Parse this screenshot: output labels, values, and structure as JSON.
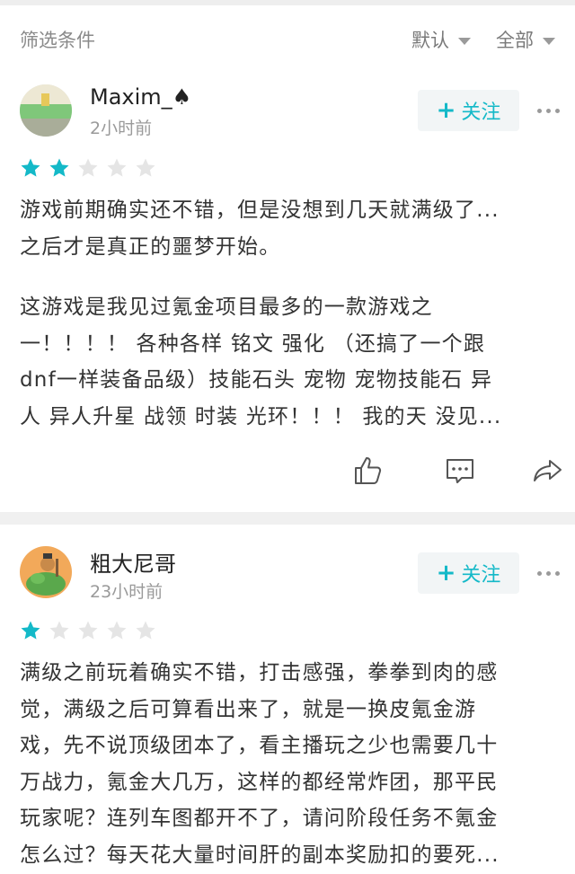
{
  "filter": {
    "label": "筛选条件",
    "sort": "默认",
    "scope": "全部"
  },
  "reviews": [
    {
      "username": "Maxim_♠",
      "time": "2小时前",
      "follow_label": "关注",
      "rating": 2,
      "max_rating": 5,
      "para1": [
        "游戏前期确实还不错，但是没想到几天就满级了...",
        "之后才是真正的噩梦开始。"
      ],
      "para2": [
        "这游戏是我见过氪金项目最多的一款游戏之",
        "一！！！！ 各种各样 铭文 强化 （还搞了一个跟",
        "dnf一样装备品级）技能石头 宠物 宠物技能石 异",
        "人 异人升星 战领 时装 光环！！！ 我的天 没见..."
      ]
    },
    {
      "username": "粗大尼哥",
      "time": "23小时前",
      "follow_label": "关注",
      "rating": 1,
      "max_rating": 5,
      "para1": [
        "满级之前玩着确实不错，打击感强，拳拳到肉的感",
        "觉，满级之后可算看出来了，就是一换皮氪金游",
        "戏，先不说顶级团本了，看主播玩之少也需要几十",
        "万战力，氪金大几万，这样的都经常炸团，那平民",
        "玩家呢？连列车图都开不了，请问阶段任务不氪金",
        "怎么过？每天花大量时间肝的副本奖励扣的要死..."
      ]
    }
  ],
  "colors": {
    "accent": "#14b9c8",
    "star_empty": "#e5e5e5"
  },
  "icons": {
    "like": "thumbs-up-icon",
    "comment": "comment-icon",
    "share": "share-icon"
  }
}
